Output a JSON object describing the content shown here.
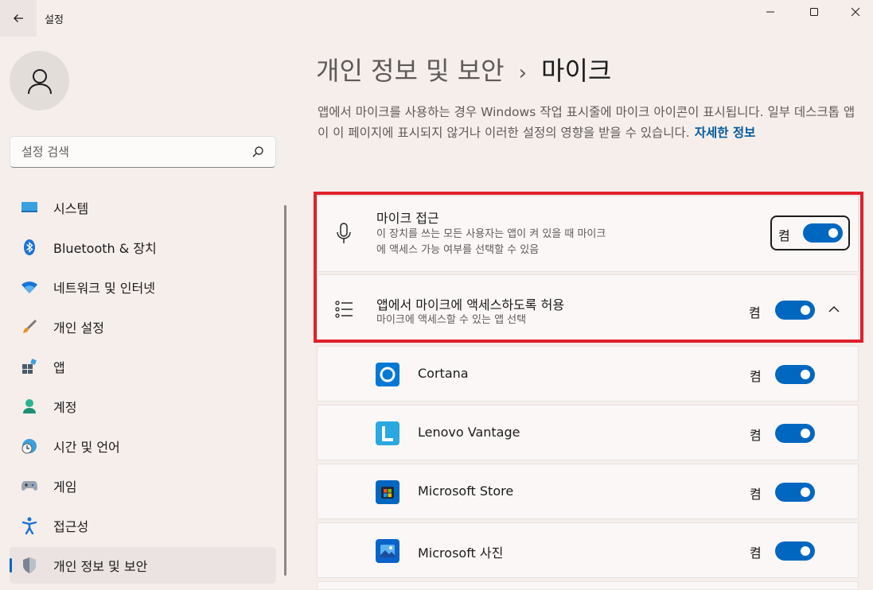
{
  "window": {
    "title": "설정"
  },
  "sidebar": {
    "search_placeholder": "설정 검색",
    "items": [
      {
        "label": "시스템",
        "icon": "system-icon"
      },
      {
        "label": "Bluetooth & 장치",
        "icon": "bluetooth-icon"
      },
      {
        "label": "네트워크 및 인터넷",
        "icon": "wifi-icon"
      },
      {
        "label": "개인 설정",
        "icon": "brush-icon"
      },
      {
        "label": "앱",
        "icon": "apps-icon"
      },
      {
        "label": "계정",
        "icon": "account-icon"
      },
      {
        "label": "시간 및 언어",
        "icon": "time-language-icon"
      },
      {
        "label": "게임",
        "icon": "gaming-icon"
      },
      {
        "label": "접근성",
        "icon": "accessibility-icon"
      },
      {
        "label": "개인 정보 및 보안",
        "icon": "shield-icon",
        "active": true
      }
    ]
  },
  "main": {
    "breadcrumb_parent": "개인 정보 및 보안",
    "breadcrumb_separator": "›",
    "breadcrumb_current": "마이크",
    "description": "앱에서 마이크를 사용하는 경우 Windows 작업 표시줄에 마이크 아이콘이 표시됩니다. 일부 데스크톱 앱이 이 페이지에 표시되지 않거나 이러한 설정의 영향을 받을 수 있습니다.",
    "learn_more": "자세한 정보",
    "mic_access": {
      "title": "마이크 접근",
      "subtitle_line1": "이 장치를 쓰는 모든 사용자는 앱이 켜 있을 때 마이크",
      "subtitle_line2": "에 액세스 가능 여부를 선택할 수 있음",
      "state": "켬",
      "on": true
    },
    "app_access": {
      "title": "앱에서 마이크에 액세스하도록 허용",
      "subtitle": "마이크에 액세스할 수 있는 앱 선택",
      "state": "켬",
      "on": true,
      "expanded": true
    },
    "apps": [
      {
        "name": "Cortana",
        "state": "켬",
        "on": true,
        "icon": "cortana-icon",
        "color": "#0078d4"
      },
      {
        "name": "Lenovo Vantage",
        "state": "켬",
        "on": true,
        "icon": "lenovo-vantage-icon",
        "color": "#2aa8e0"
      },
      {
        "name": "Microsoft Store",
        "state": "켬",
        "on": true,
        "icon": "microsoft-store-icon",
        "color": "#0067c0"
      },
      {
        "name": "Microsoft 사진",
        "state": "켬",
        "on": true,
        "icon": "photos-icon",
        "color": "#0a63c9"
      }
    ]
  },
  "colors": {
    "accent": "#0067c0",
    "highlight_border": "#e0202b",
    "background": "#f6eeeb"
  }
}
